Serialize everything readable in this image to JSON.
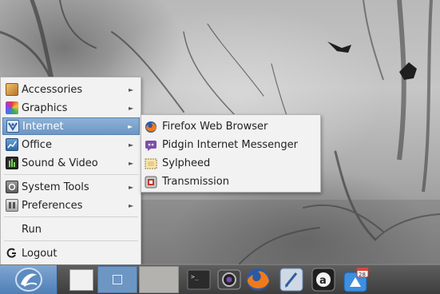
{
  "menu": {
    "items": [
      {
        "label": "Accessories",
        "icon": "accessories-icon",
        "submenu": true
      },
      {
        "label": "Graphics",
        "icon": "graphics-icon",
        "submenu": true
      },
      {
        "label": "Internet",
        "icon": "internet-icon",
        "submenu": true,
        "active": true
      },
      {
        "label": "Office",
        "icon": "office-icon",
        "submenu": true
      },
      {
        "label": "Sound & Video",
        "icon": "sound-video-icon",
        "submenu": true
      },
      {
        "label": "System Tools",
        "icon": "system-tools-icon",
        "submenu": true
      },
      {
        "label": "Preferences",
        "icon": "preferences-icon",
        "submenu": true
      },
      {
        "label": "Run",
        "icon": "",
        "submenu": false
      },
      {
        "label": "Logout",
        "icon": "logout-icon",
        "submenu": false
      }
    ]
  },
  "submenu": {
    "items": [
      {
        "label": "Firefox Web Browser",
        "icon": "firefox-icon"
      },
      {
        "label": "Pidgin Internet Messenger",
        "icon": "pidgin-icon"
      },
      {
        "label": "Sylpheed",
        "icon": "sylpheed-icon"
      },
      {
        "label": "Transmission",
        "icon": "transmission-icon"
      }
    ]
  },
  "taskbar": {
    "start_icon": "lxde-logo-icon",
    "launchers": [
      "terminal-icon",
      "camera-icon",
      "firefox-icon",
      "text-editor-icon",
      "amazon-icon",
      "software-center-icon"
    ],
    "calendar_day": "28"
  },
  "colors": {
    "highlight": "#6d96c3",
    "menu_bg": "#f2f2f2",
    "taskbar": "#3d3d3d"
  }
}
